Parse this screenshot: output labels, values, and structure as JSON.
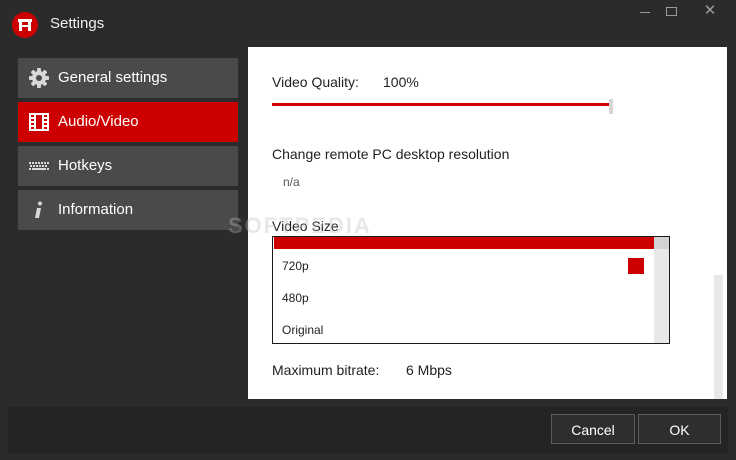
{
  "window": {
    "title": "Settings",
    "close_glyph": "✕",
    "icons": {
      "logo": "app-logo-icon",
      "minimize": "minimize-icon",
      "maximize": "maximize-icon",
      "close": "close-icon"
    }
  },
  "sidebar": {
    "items": [
      {
        "label": "General settings",
        "icon": "gear-icon",
        "active": false
      },
      {
        "label": "Audio/Video",
        "icon": "film-icon",
        "active": true
      },
      {
        "label": "Hotkeys",
        "icon": "keyboard-icon",
        "active": false
      },
      {
        "label": "Information",
        "icon": "info-icon",
        "active": false
      }
    ]
  },
  "content": {
    "video_quality": {
      "label": "Video Quality:",
      "value": "100%",
      "level": 1.0
    },
    "resolution": {
      "label": "Change remote PC desktop resolution",
      "value": "n/a"
    },
    "video_size": {
      "label": "Video Size",
      "options": [
        "720p",
        "480p",
        "Original"
      ],
      "checked": "720p"
    },
    "bitrate": {
      "label": "Maximum bitrate:",
      "value": "6 Mbps"
    }
  },
  "watermark": "SOFTPEDIA",
  "footer": {
    "cancel_label": "Cancel",
    "ok_label": "OK"
  },
  "colors": {
    "accent": "#cc0000",
    "background": "#2b2b2b",
    "nav_item": "#4a4a4a",
    "panel": "#ffffff"
  }
}
